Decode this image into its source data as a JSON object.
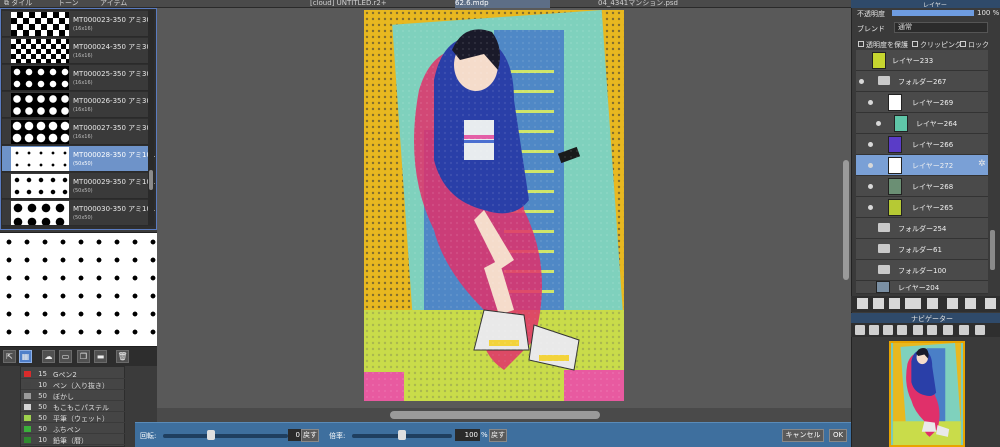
{
  "tabs": [
    {
      "label": "⧉ タイル"
    },
    {
      "label": "トーン"
    },
    {
      "label": "アイテム"
    },
    {
      "label": "[cloud] UNTITLED.r2+"
    },
    {
      "label": "62.6.mdp"
    },
    {
      "label": "04_4341マンション.psd"
    }
  ],
  "materials": [
    {
      "name": "MT000023-350 アミ30",
      "size": "(16x16)"
    },
    {
      "name": "MT000024-350 アミ30",
      "size": "(16x16)"
    },
    {
      "name": "MT000025-350 アミ30",
      "size": "(16x16)"
    },
    {
      "name": "MT000026-350 アミ30",
      "size": "(16x16)"
    },
    {
      "name": "MT000027-350 アミ30",
      "size": "(16x16)"
    },
    {
      "name": "MT000028-350 アミ10L",
      "size": "(50x50)",
      "selected": true
    },
    {
      "name": "MT000029-350 アミ10L",
      "size": "(50x50)"
    },
    {
      "name": "MT000030-350 アミ10L",
      "size": "(50x50)"
    }
  ],
  "brushes": [
    {
      "size": "15",
      "name": "Gペン2",
      "color": "#d92b2b"
    },
    {
      "size": "10",
      "name": "ペン（入り抜き）",
      "color": "#444444"
    },
    {
      "size": "50",
      "name": "ぼかし",
      "color": "#9b9b9b"
    },
    {
      "size": "50",
      "name": "もこもこパステル",
      "color": "#d4d4d4"
    },
    {
      "size": "50",
      "name": "平筆（ウェット）",
      "color": "#9ed14d"
    },
    {
      "size": "50",
      "name": "ふちペン",
      "color": "#3bb03b"
    },
    {
      "size": "10",
      "name": "鉛筆（暦）",
      "color": "#2f8a2f"
    }
  ],
  "bottom_bar": {
    "rotate_label": "回転:",
    "rotate_value": "0",
    "rotate_unit": "度",
    "rotate_reset": "戻す",
    "zoom_label": "倍率:",
    "zoom_value": "100",
    "zoom_unit": "%",
    "zoom_reset": "戻す",
    "cancel": "キャンセル",
    "ok": "OK"
  },
  "layer_panel": {
    "header": "レイヤー",
    "opacity_label": "不透明度",
    "opacity_value": "100 %",
    "opacity_fraction": 1.0,
    "blend_label": "ブレンド",
    "blend_value": "通常",
    "protect_label": "透明度を保護",
    "clipping_label": "クリッピング",
    "lock_label": "ロック",
    "layers": [
      {
        "name": "レイヤー233",
        "type": "layer",
        "thumb": "#c7d62f",
        "indent": 0
      },
      {
        "name": "フォルダー267",
        "type": "folder",
        "indent": 0
      },
      {
        "name": "レイヤー269",
        "type": "layer",
        "thumb": "#ffffff",
        "indent": 1
      },
      {
        "name": "レイヤー264",
        "type": "layer",
        "thumb": "#5fc6a8",
        "indent": 2
      },
      {
        "name": "レイヤー266",
        "type": "layer",
        "thumb": "#5a3cc7",
        "indent": 1
      },
      {
        "name": "レイヤー272",
        "type": "layer",
        "thumb": "#ffffff",
        "indent": 1,
        "selected": true
      },
      {
        "name": "レイヤー268",
        "type": "layer",
        "thumb": "#6b8f74",
        "indent": 1
      },
      {
        "name": "レイヤー265",
        "type": "layer",
        "thumb": "#b6c934",
        "indent": 1
      },
      {
        "name": "フォルダー254",
        "type": "folder",
        "indent": 0
      },
      {
        "name": "フォルダー61",
        "type": "folder",
        "indent": 0
      },
      {
        "name": "フォルダー100",
        "type": "folder",
        "indent": 0
      },
      {
        "name": "レイヤー204",
        "type": "layer",
        "thumb": "#7a8fa3",
        "indent": 0
      }
    ]
  },
  "navigator": {
    "header": "ナビゲーター"
  }
}
